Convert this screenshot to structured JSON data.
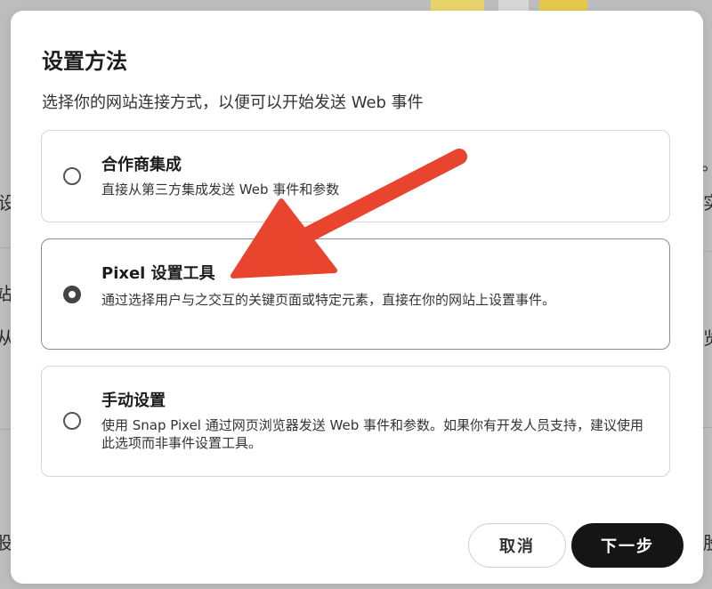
{
  "dialog": {
    "title": "设置方法",
    "subtitle": "选择你的网站连接方式，以便可以开始发送 Web 事件"
  },
  "options": [
    {
      "title": "合作商集成",
      "description": "直接从第三方集成发送 Web 事件和参数",
      "selected": false
    },
    {
      "title": "Pixel 设置工具",
      "description": "通过选择用户与之交互的关键页面或特定元素，直接在你的网站上设置事件。",
      "selected": true
    },
    {
      "title": "手动设置",
      "description": "使用 Snap Pixel 通过网页浏览器发送 Web 事件和参数。如果你有开发人员支持，建议使用此选项而非事件设置工具。",
      "selected": false
    }
  ],
  "footer": {
    "cancel_label": "取消",
    "next_label": "下一步"
  },
  "background": {
    "fragments": [
      "设",
      "站",
      "从",
      "股",
      "。",
      "实",
      "览",
      "股"
    ]
  },
  "colors": {
    "annotation_arrow": "#e8442e",
    "primary_button": "#151515",
    "overlay": "#bdbdbd"
  }
}
